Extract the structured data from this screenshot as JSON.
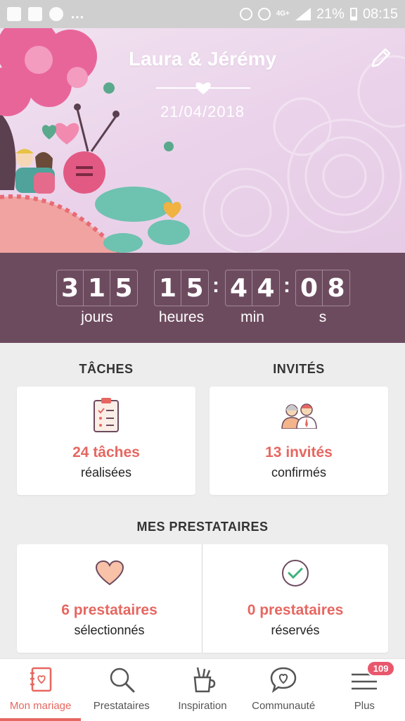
{
  "status_bar": {
    "battery": "21%",
    "time": "08:15",
    "network": "4G+"
  },
  "hero": {
    "names": "Laura & Jérémy",
    "date": "21/04/2018"
  },
  "countdown": {
    "days": [
      "3",
      "1",
      "5"
    ],
    "hours": [
      "1",
      "5"
    ],
    "minutes": [
      "4",
      "4"
    ],
    "seconds": [
      "0",
      "8"
    ],
    "labels": {
      "days": "jours",
      "hours": "heures",
      "minutes": "min",
      "seconds": "s"
    }
  },
  "tasks": {
    "title": "TÂCHES",
    "value": "24 tâches",
    "sub": "réalisées"
  },
  "guests": {
    "title": "INVITÉS",
    "value": "13 invités",
    "sub": "confirmés"
  },
  "vendors": {
    "title": "MES PRESTATAIRES",
    "selected": {
      "value": "6 prestataires",
      "sub": "sélectionnés"
    },
    "reserved": {
      "value": "0 prestataires",
      "sub": "réservés"
    }
  },
  "nav": {
    "items": [
      {
        "label": "Mon mariage",
        "icon": "notebook-icon",
        "active": true
      },
      {
        "label": "Prestataires",
        "icon": "search-icon"
      },
      {
        "label": "Inspiration",
        "icon": "pencil-cup-icon"
      },
      {
        "label": "Communauté",
        "icon": "chat-heart-icon"
      },
      {
        "label": "Plus",
        "icon": "menu-icon",
        "badge": "109"
      }
    ]
  },
  "colors": {
    "accent": "#e66760",
    "countdown_bg": "#6d4b5f"
  }
}
